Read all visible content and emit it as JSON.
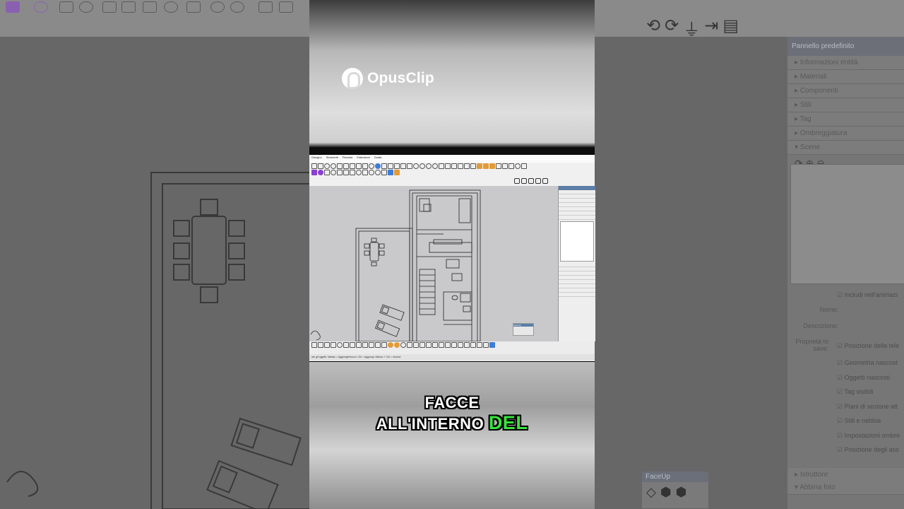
{
  "background_app": {
    "panel_title": "Pannello predefinito",
    "sections": [
      {
        "label": "Informazioni entità",
        "open": false
      },
      {
        "label": "Materiali",
        "open": false
      },
      {
        "label": "Componenti",
        "open": false
      },
      {
        "label": "Stili",
        "open": false
      },
      {
        "label": "Tag",
        "open": false
      },
      {
        "label": "Ombreggiatura",
        "open": false
      },
      {
        "label": "Scene",
        "open": true
      }
    ],
    "scene_options": {
      "include_label": "Includi nell'animazi",
      "name_label": "Nome:",
      "description_label": "Descrizione:",
      "properties_label": "Proprietà to save:",
      "checkboxes": [
        "Posizione della tele",
        "Geometria nascost",
        "Oggetti nascosti",
        "Tag visibili",
        "Piani di sezione att",
        "Stili e nebbia",
        "Impostazioni ombre",
        "Posizione degli ass"
      ]
    },
    "bottom_sections": [
      {
        "label": "Istruttore",
        "open": false
      },
      {
        "label": "Abbina foto",
        "open": true
      }
    ],
    "faceup_title": "FaceUp"
  },
  "overlay": {
    "logo_text": "OpusClip"
  },
  "screen_capture": {
    "menu_items": [
      "Disegno",
      "Strumenti",
      "Finestra",
      "Estensioni",
      "Guida"
    ],
    "status_text": "are gli oggetti. Maiusc = Aggiungi/rimuovi. Ctrl = Aggiungi. Maiusc + Ctrl = rimuovi."
  },
  "caption": {
    "line1": "FACCE",
    "line2_text": "ALL'INTERNO",
    "line2_highlight": "DEL",
    "highlight_color": "#38e23a"
  }
}
